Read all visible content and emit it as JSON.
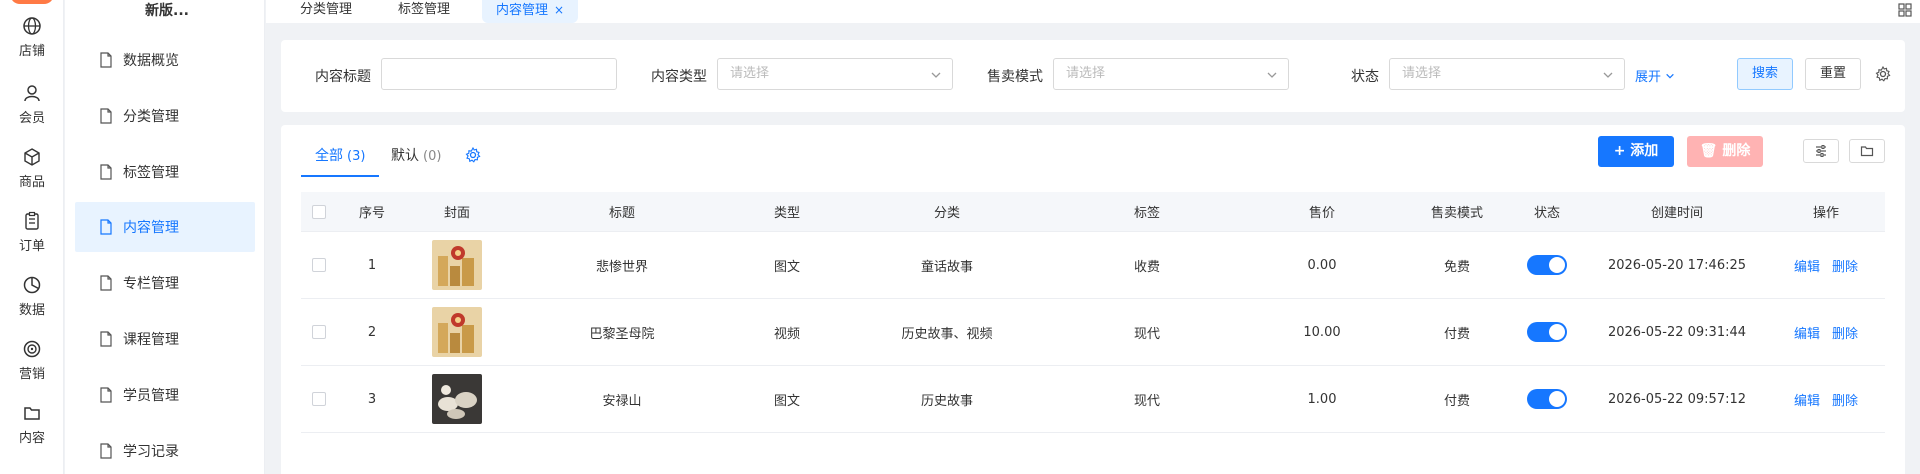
{
  "rail": {
    "items": [
      {
        "label": "店铺",
        "icon": "globe-icon"
      },
      {
        "label": "会员",
        "icon": "user-icon"
      },
      {
        "label": "商品",
        "icon": "cube-icon"
      },
      {
        "label": "订单",
        "icon": "clipboard-icon"
      },
      {
        "label": "数据",
        "icon": "pie-chart-icon"
      },
      {
        "label": "营销",
        "icon": "target-icon"
      },
      {
        "label": "内容",
        "icon": "folder-icon"
      }
    ]
  },
  "sidebar": {
    "title": "新版...",
    "items": [
      {
        "label": "数据概览"
      },
      {
        "label": "分类管理"
      },
      {
        "label": "标签管理"
      },
      {
        "label": "内容管理",
        "active": true
      },
      {
        "label": "专栏管理"
      },
      {
        "label": "课程管理"
      },
      {
        "label": "学员管理"
      },
      {
        "label": "学习记录"
      }
    ]
  },
  "tabs": [
    {
      "label": "分类管理"
    },
    {
      "label": "标签管理"
    },
    {
      "label": "内容管理",
      "active": true,
      "close": "×"
    }
  ],
  "filter": {
    "title_label": "内容标题",
    "title_value": "",
    "type_label": "内容类型",
    "type_placeholder": "请选择",
    "mode_label": "售卖模式",
    "mode_placeholder": "请选择",
    "status_label": "状态",
    "status_placeholder": "请选择",
    "expand_label": "展开",
    "search_label": "搜索",
    "reset_label": "重置"
  },
  "main": {
    "tabs": [
      {
        "label": "全部",
        "count": "(3)",
        "active": true
      },
      {
        "label": "默认",
        "count": "(0)"
      }
    ],
    "add_label": "添加",
    "delete_label": "删除"
  },
  "table": {
    "headers": [
      "序号",
      "封面",
      "标题",
      "类型",
      "分类",
      "标签",
      "售价",
      "售卖模式",
      "状态",
      "创建时间",
      "操作"
    ],
    "edit_label": "编辑",
    "delete_label": "删除",
    "rows": [
      {
        "index": "1",
        "title": "悲惨世界",
        "type": "图文",
        "category": "童话故事",
        "tag": "收费",
        "price": "0.00",
        "mode": "免费",
        "status": true,
        "created": "2026-05-20 17:46:25",
        "cover": "gold"
      },
      {
        "index": "2",
        "title": "巴黎圣母院",
        "type": "视频",
        "category": "历史故事、视频",
        "tag": "现代",
        "price": "10.00",
        "mode": "付费",
        "status": true,
        "created": "2026-05-22 09:31:44",
        "cover": "gold"
      },
      {
        "index": "3",
        "title": "安禄山",
        "type": "图文",
        "category": "历史故事",
        "tag": "现代",
        "price": "1.00",
        "mode": "付费",
        "status": true,
        "created": "2026-05-22 09:57:12",
        "cover": "dark"
      }
    ]
  },
  "colors": {
    "primary": "#1677ff",
    "danger_disabled": "#ffb3b3",
    "active_bg": "#e8f3ff"
  }
}
